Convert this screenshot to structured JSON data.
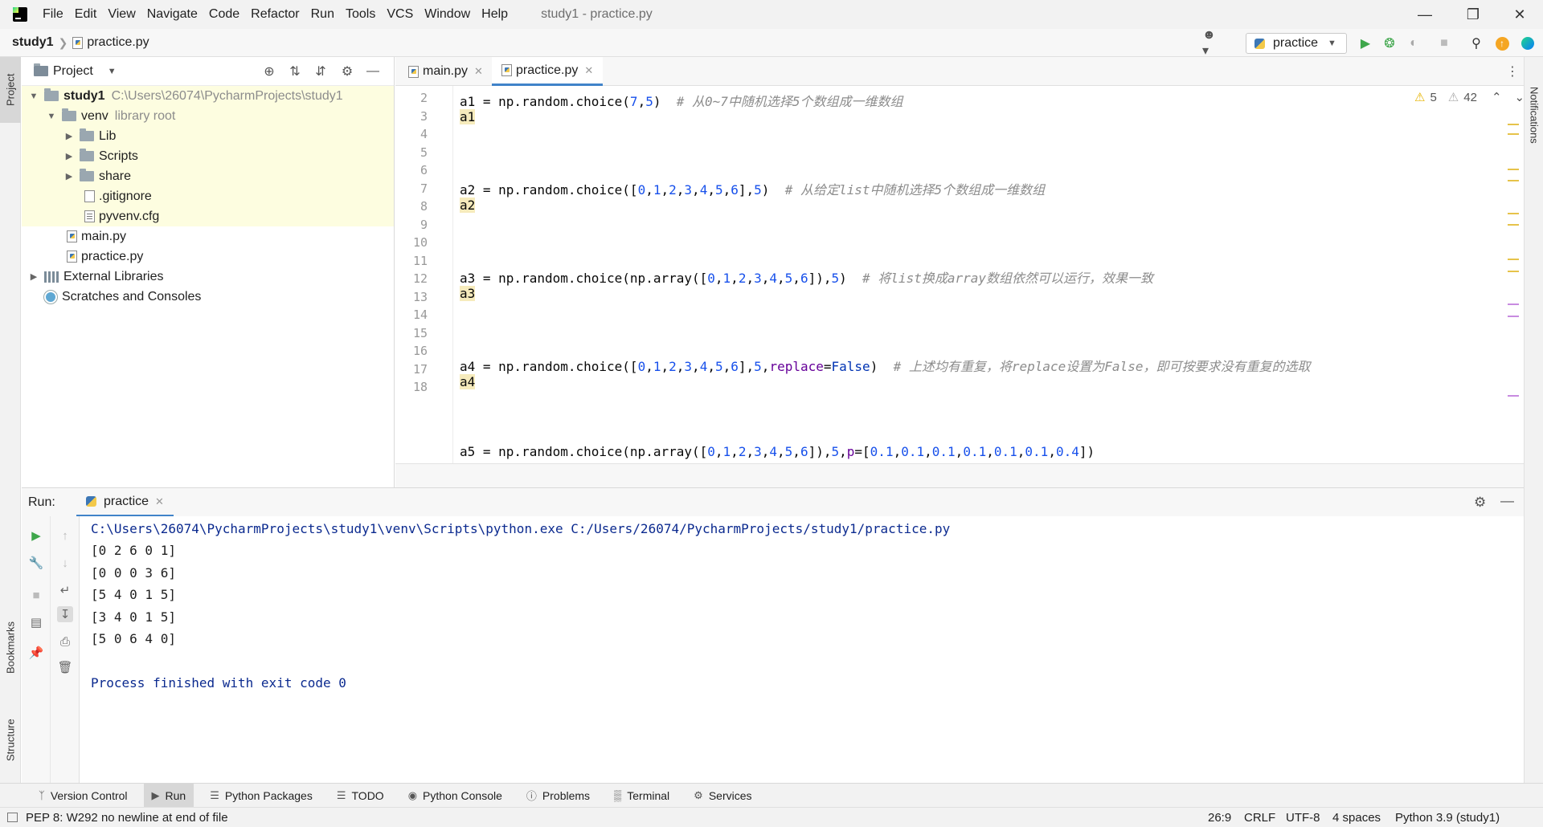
{
  "menubar": {
    "items": [
      "File",
      "Edit",
      "View",
      "Navigate",
      "Code",
      "Refactor",
      "Run",
      "Tools",
      "VCS",
      "Window",
      "Help"
    ],
    "window_title": "study1 - practice.py"
  },
  "navbar": {
    "project": "study1",
    "file": "practice.py",
    "run_config": "practice"
  },
  "left_stripe": {
    "project_tab": "Project",
    "bookmarks_tab": "Bookmarks",
    "structure_tab": "Structure"
  },
  "right_stripe": {
    "notifications_tab": "Notifications"
  },
  "project_panel": {
    "title": "Project",
    "tree": [
      {
        "label": "study1",
        "extra": "C:\\Users\\26074\\PycharmProjects\\study1"
      },
      {
        "label": "venv",
        "extra": "library root"
      },
      {
        "label": "Lib"
      },
      {
        "label": "Scripts"
      },
      {
        "label": "share"
      },
      {
        "label": ".gitignore"
      },
      {
        "label": "pyvenv.cfg"
      },
      {
        "label": "main.py"
      },
      {
        "label": "practice.py"
      },
      {
        "label": "External Libraries"
      },
      {
        "label": "Scratches and Consoles"
      }
    ]
  },
  "editor": {
    "tabs": [
      "main.py",
      "practice.py"
    ],
    "warnings": "5",
    "weak_warnings": "42",
    "line_numbers": [
      "2",
      "3",
      "4",
      "5",
      "6",
      "7",
      "8",
      "9",
      "10",
      "11",
      "12",
      "13",
      "14",
      "15",
      "16",
      "17",
      "18"
    ],
    "code": {
      "l2_head": "a1 = np.random.choice(",
      "l2_n1": "7",
      "l2_n2": "5",
      "l2_comment": "# 从0~7中随机选择5个数组成一维数组",
      "l3": "a1",
      "l6_head": "a2 = np.random.choice([",
      "l6_nums": [
        "0",
        "1",
        "2",
        "3",
        "4",
        "5",
        "6"
      ],
      "l6_size": "5",
      "l6_comment": "# 从给定list中随机选择5个数组成一维数组",
      "l7": "a2",
      "l10_head": "a3 = np.random.choice(np.array([",
      "l10_nums": [
        "0",
        "1",
        "2",
        "3",
        "4",
        "5",
        "6"
      ],
      "l10_size": "5",
      "l10_comment": "# 将list换成array数组依然可以运行，效果一致",
      "l11": "a3",
      "l14_head": "a4 = np.random.choice([",
      "l14_nums": [
        "0",
        "1",
        "2",
        "3",
        "4",
        "5",
        "6"
      ],
      "l14_size": "5",
      "l14_kwarg": "replace",
      "l14_value": "False",
      "l14_comment": "# 上述均有重复，将replace设置为False，即可按要求没有重复的选取",
      "l15": "a4",
      "l18_head": "a5 = np.random.choice(np.array([",
      "l18_nums": [
        "0",
        "1",
        "2",
        "3",
        "4",
        "5",
        "6"
      ],
      "l18_size": "5",
      "l18_kwarg": "p",
      "l18_probs": [
        "0.1",
        "0.1",
        "0.1",
        "0.1",
        "0.1",
        "0.1",
        "0.4"
      ]
    }
  },
  "run_panel": {
    "label": "Run:",
    "tab": "practice",
    "console": [
      "C:\\Users\\26074\\PycharmProjects\\study1\\venv\\Scripts\\python.exe C:/Users/26074/PycharmProjects/study1/practice.py",
      "[0 2 6 0 1]",
      "[0 0 0 3 6]",
      "[5 4 0 1 5]",
      "[3 4 0 1 5]",
      "[5 0 6 4 0]",
      "",
      "Process finished with exit code 0"
    ]
  },
  "toolwindows": [
    "Version Control",
    "Run",
    "Python Packages",
    "TODO",
    "Python Console",
    "Problems",
    "Terminal",
    "Services"
  ],
  "statusbar": {
    "message": "PEP 8: W292 no newline at end of file",
    "position": "26:9",
    "line_sep": "CRLF",
    "encoding": "UTF-8",
    "indent": "4 spaces",
    "interpreter": "Python 3.9 (study1)"
  },
  "colors": {
    "accent": "#4083c9",
    "library_highlight": "#fdfde0",
    "number": "#1750eb",
    "keyword_arg": "#660099",
    "comment": "#8c8c8c",
    "console_blue": "#0b2a8f"
  },
  "icons": [
    "app-logo-icon",
    "user-icon",
    "run-icon",
    "debug-icon",
    "coverage-icon",
    "stop-icon",
    "search-icon",
    "update-icon",
    "plugin-icon",
    "folder-icon",
    "python-file-icon",
    "gear-icon",
    "minimize-icon",
    "locate-icon",
    "expand-all-icon",
    "collapse-all-icon",
    "warning-icon"
  ]
}
